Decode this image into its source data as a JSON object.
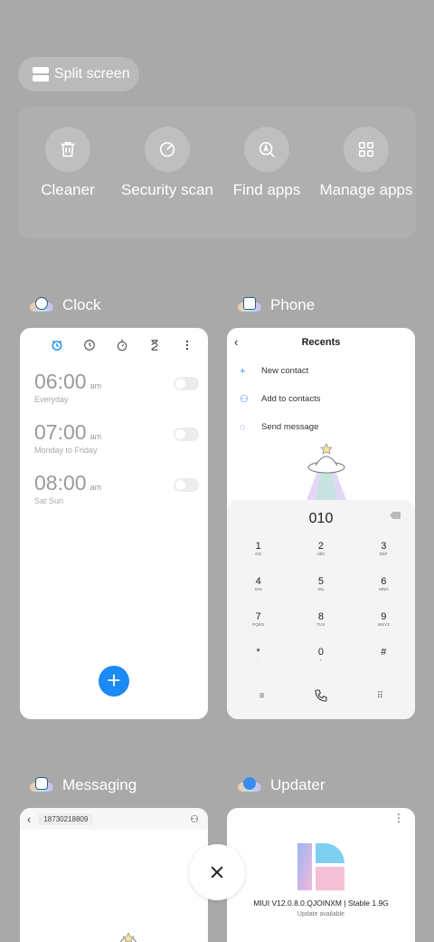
{
  "split_screen_label": "Split screen",
  "tools": [
    {
      "label": "Cleaner"
    },
    {
      "label": "Security scan"
    },
    {
      "label": "Find apps"
    },
    {
      "label": "Manage apps"
    }
  ],
  "clock": {
    "title": "Clock",
    "alarms": [
      {
        "time": "06:00",
        "ampm": "am",
        "repeat": "Everyday"
      },
      {
        "time": "07:00",
        "ampm": "am",
        "repeat": "Monday to Friday"
      },
      {
        "time": "08:00",
        "ampm": "am",
        "repeat": "Sat Sun"
      }
    ],
    "fab": "+"
  },
  "phone": {
    "title": "Phone",
    "header": "Recents",
    "actions": [
      "New contact",
      "Add to contacts",
      "Send message"
    ],
    "dialed": "010",
    "keys": [
      {
        "d": "1",
        "l": "GO"
      },
      {
        "d": "2",
        "l": "ABC"
      },
      {
        "d": "3",
        "l": "DEF"
      },
      {
        "d": "4",
        "l": "GHI"
      },
      {
        "d": "5",
        "l": "JKL"
      },
      {
        "d": "6",
        "l": "MNO"
      },
      {
        "d": "7",
        "l": "PQRS"
      },
      {
        "d": "8",
        "l": "TUV"
      },
      {
        "d": "9",
        "l": "WXYZ"
      },
      {
        "d": "*",
        "l": ","
      },
      {
        "d": "0",
        "l": "+"
      },
      {
        "d": "#",
        "l": ""
      }
    ]
  },
  "messaging": {
    "title": "Messaging",
    "number": "18730218809"
  },
  "updater": {
    "title": "Updater",
    "version": "MIUI V12.0.8.0.QJOINXM | Stable 1.9G",
    "status": "Update available"
  },
  "colors": {
    "background": "#a9a9a9",
    "accent": "#1a8af5"
  }
}
